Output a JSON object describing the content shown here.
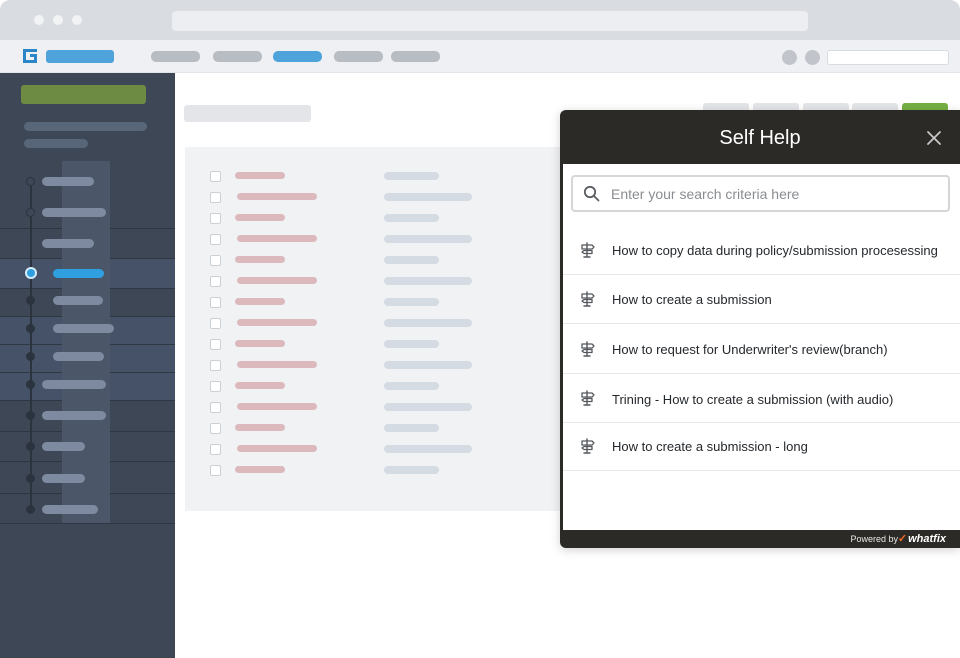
{
  "self_help": {
    "title": "Self Help",
    "search_placeholder": "Enter your search criteria here",
    "items": [
      {
        "label": "How to copy data during policy/submission procesessing"
      },
      {
        "label": "How to create a submission"
      },
      {
        "label": "How to request for Underwriter's review(branch)"
      },
      {
        "label": "Trining - How to create a submission (with audio)"
      },
      {
        "label": "How to create a submission - long"
      }
    ],
    "powered_by": "Powered by",
    "brand": "whatfix",
    "brand_color": "#f26b21"
  },
  "icons": {
    "app_logo": "g-logo-icon",
    "search": "search-icon",
    "close": "close-icon",
    "item": "signpost-icon"
  },
  "colors": {
    "sidebar": "#3d4756",
    "accent": "#4ea3db",
    "panel_header": "#2b2a26",
    "green_button": "#76b043"
  }
}
